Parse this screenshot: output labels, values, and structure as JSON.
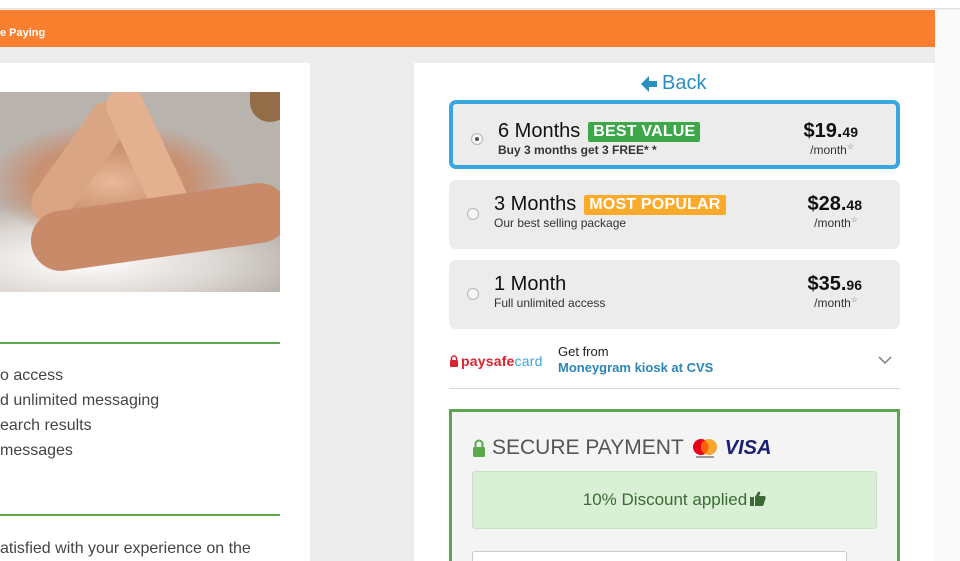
{
  "banner": {
    "text": "e Paying"
  },
  "left": {
    "features": [
      "o access",
      "d unlimited messaging",
      "earch results",
      " messages"
    ],
    "bottom_text": "atisfied with your experience on the"
  },
  "back": {
    "label": "Back"
  },
  "plans": [
    {
      "name": "6 Months",
      "badge": "BEST VALUE",
      "subtitle": "Buy 3 months get 3 FREE* *",
      "price_main": "$19.",
      "price_cents": "49",
      "per": "/month",
      "selected": true
    },
    {
      "name": "3 Months",
      "badge": "MOST POPULAR",
      "subtitle": "Our best selling package",
      "price_main": "$28.",
      "price_cents": "48",
      "per": "/month",
      "selected": false
    },
    {
      "name": "1 Month",
      "badge": "",
      "subtitle": "Full unlimited access",
      "price_main": "$35.",
      "price_cents": "96",
      "per": "/month",
      "selected": false
    }
  ],
  "paysafe": {
    "logo_a": "paysafe",
    "logo_b": "card",
    "get_from": "Get from",
    "where": "Moneygram kiosk at CVS"
  },
  "secure": {
    "title": "SECURE PAYMENT",
    "visa": "VISA",
    "discount": "10% Discount applied"
  },
  "colors": {
    "banner": "#fa7f2f",
    "selected_border": "#3aa6e1",
    "best_value": "#3ea74a",
    "most_popular": "#fbaa2a",
    "secure_border": "#5ba84c",
    "link": "#2a8fbd"
  }
}
